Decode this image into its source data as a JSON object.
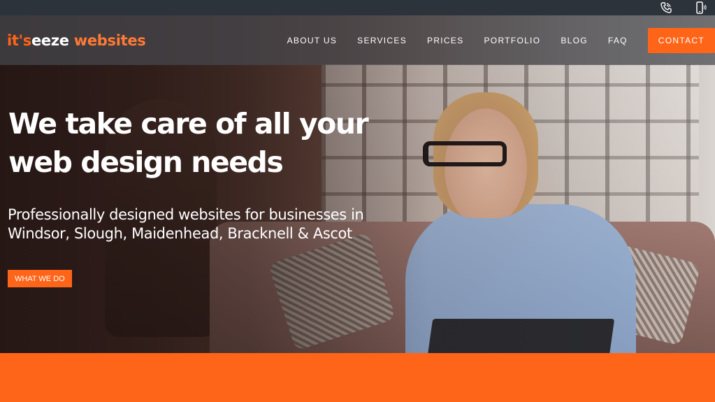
{
  "topbar": {
    "phone_icon": "phone-icon",
    "mobile_icon": "mobile-phone-icon"
  },
  "logo": {
    "part1": "it's",
    "part2": "eeze",
    "part3": " websites"
  },
  "nav": {
    "items": [
      {
        "label": "ABOUT US"
      },
      {
        "label": "SERVICES"
      },
      {
        "label": "PRICES"
      },
      {
        "label": "PORTFOLIO"
      },
      {
        "label": "BLOG"
      },
      {
        "label": "FAQ"
      }
    ],
    "contact_label": "CONTACT"
  },
  "hero": {
    "headline_line1": "We take care of all your",
    "headline_line2": "web design needs",
    "sub_line1": "Professionally designed websites for businesses in",
    "sub_line2": "Windsor, Slough, Maidenhead, Bracknell & Ascot",
    "cta_label": "WHAT WE DO"
  },
  "colors": {
    "accent": "#ff6519",
    "topbar": "#2c333b",
    "nav_overlay": "#46484e"
  }
}
